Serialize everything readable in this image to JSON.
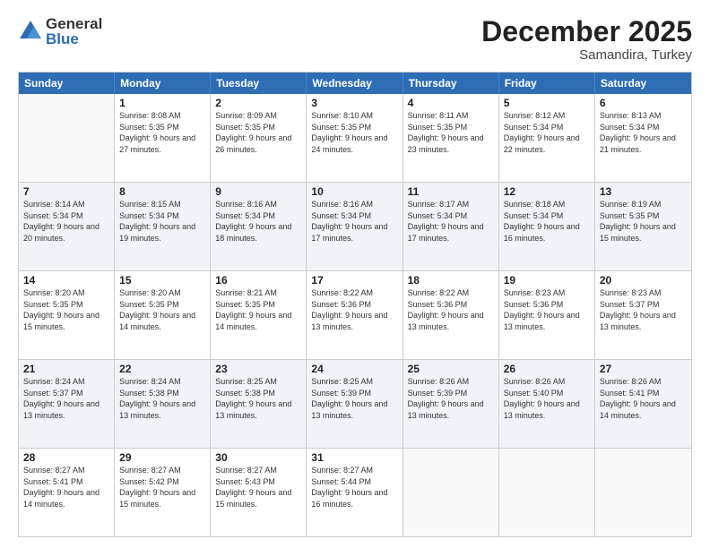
{
  "logo": {
    "general": "General",
    "blue": "Blue"
  },
  "title": {
    "month": "December 2025",
    "location": "Samandira, Turkey"
  },
  "header_days": [
    "Sunday",
    "Monday",
    "Tuesday",
    "Wednesday",
    "Thursday",
    "Friday",
    "Saturday"
  ],
  "rows": [
    {
      "cells": [
        {
          "day": "",
          "sunrise": "",
          "sunset": "",
          "daylight": "",
          "empty": true
        },
        {
          "day": "1",
          "sunrise": "Sunrise: 8:08 AM",
          "sunset": "Sunset: 5:35 PM",
          "daylight": "Daylight: 9 hours and 27 minutes."
        },
        {
          "day": "2",
          "sunrise": "Sunrise: 8:09 AM",
          "sunset": "Sunset: 5:35 PM",
          "daylight": "Daylight: 9 hours and 26 minutes."
        },
        {
          "day": "3",
          "sunrise": "Sunrise: 8:10 AM",
          "sunset": "Sunset: 5:35 PM",
          "daylight": "Daylight: 9 hours and 24 minutes."
        },
        {
          "day": "4",
          "sunrise": "Sunrise: 8:11 AM",
          "sunset": "Sunset: 5:35 PM",
          "daylight": "Daylight: 9 hours and 23 minutes."
        },
        {
          "day": "5",
          "sunrise": "Sunrise: 8:12 AM",
          "sunset": "Sunset: 5:34 PM",
          "daylight": "Daylight: 9 hours and 22 minutes."
        },
        {
          "day": "6",
          "sunrise": "Sunrise: 8:13 AM",
          "sunset": "Sunset: 5:34 PM",
          "daylight": "Daylight: 9 hours and 21 minutes."
        }
      ]
    },
    {
      "cells": [
        {
          "day": "7",
          "sunrise": "Sunrise: 8:14 AM",
          "sunset": "Sunset: 5:34 PM",
          "daylight": "Daylight: 9 hours and 20 minutes."
        },
        {
          "day": "8",
          "sunrise": "Sunrise: 8:15 AM",
          "sunset": "Sunset: 5:34 PM",
          "daylight": "Daylight: 9 hours and 19 minutes."
        },
        {
          "day": "9",
          "sunrise": "Sunrise: 8:16 AM",
          "sunset": "Sunset: 5:34 PM",
          "daylight": "Daylight: 9 hours and 18 minutes."
        },
        {
          "day": "10",
          "sunrise": "Sunrise: 8:16 AM",
          "sunset": "Sunset: 5:34 PM",
          "daylight": "Daylight: 9 hours and 17 minutes."
        },
        {
          "day": "11",
          "sunrise": "Sunrise: 8:17 AM",
          "sunset": "Sunset: 5:34 PM",
          "daylight": "Daylight: 9 hours and 17 minutes."
        },
        {
          "day": "12",
          "sunrise": "Sunrise: 8:18 AM",
          "sunset": "Sunset: 5:34 PM",
          "daylight": "Daylight: 9 hours and 16 minutes."
        },
        {
          "day": "13",
          "sunrise": "Sunrise: 8:19 AM",
          "sunset": "Sunset: 5:35 PM",
          "daylight": "Daylight: 9 hours and 15 minutes."
        }
      ]
    },
    {
      "cells": [
        {
          "day": "14",
          "sunrise": "Sunrise: 8:20 AM",
          "sunset": "Sunset: 5:35 PM",
          "daylight": "Daylight: 9 hours and 15 minutes."
        },
        {
          "day": "15",
          "sunrise": "Sunrise: 8:20 AM",
          "sunset": "Sunset: 5:35 PM",
          "daylight": "Daylight: 9 hours and 14 minutes."
        },
        {
          "day": "16",
          "sunrise": "Sunrise: 8:21 AM",
          "sunset": "Sunset: 5:35 PM",
          "daylight": "Daylight: 9 hours and 14 minutes."
        },
        {
          "day": "17",
          "sunrise": "Sunrise: 8:22 AM",
          "sunset": "Sunset: 5:36 PM",
          "daylight": "Daylight: 9 hours and 13 minutes."
        },
        {
          "day": "18",
          "sunrise": "Sunrise: 8:22 AM",
          "sunset": "Sunset: 5:36 PM",
          "daylight": "Daylight: 9 hours and 13 minutes."
        },
        {
          "day": "19",
          "sunrise": "Sunrise: 8:23 AM",
          "sunset": "Sunset: 5:36 PM",
          "daylight": "Daylight: 9 hours and 13 minutes."
        },
        {
          "day": "20",
          "sunrise": "Sunrise: 8:23 AM",
          "sunset": "Sunset: 5:37 PM",
          "daylight": "Daylight: 9 hours and 13 minutes."
        }
      ]
    },
    {
      "cells": [
        {
          "day": "21",
          "sunrise": "Sunrise: 8:24 AM",
          "sunset": "Sunset: 5:37 PM",
          "daylight": "Daylight: 9 hours and 13 minutes."
        },
        {
          "day": "22",
          "sunrise": "Sunrise: 8:24 AM",
          "sunset": "Sunset: 5:38 PM",
          "daylight": "Daylight: 9 hours and 13 minutes."
        },
        {
          "day": "23",
          "sunrise": "Sunrise: 8:25 AM",
          "sunset": "Sunset: 5:38 PM",
          "daylight": "Daylight: 9 hours and 13 minutes."
        },
        {
          "day": "24",
          "sunrise": "Sunrise: 8:25 AM",
          "sunset": "Sunset: 5:39 PM",
          "daylight": "Daylight: 9 hours and 13 minutes."
        },
        {
          "day": "25",
          "sunrise": "Sunrise: 8:26 AM",
          "sunset": "Sunset: 5:39 PM",
          "daylight": "Daylight: 9 hours and 13 minutes."
        },
        {
          "day": "26",
          "sunrise": "Sunrise: 8:26 AM",
          "sunset": "Sunset: 5:40 PM",
          "daylight": "Daylight: 9 hours and 13 minutes."
        },
        {
          "day": "27",
          "sunrise": "Sunrise: 8:26 AM",
          "sunset": "Sunset: 5:41 PM",
          "daylight": "Daylight: 9 hours and 14 minutes."
        }
      ]
    },
    {
      "cells": [
        {
          "day": "28",
          "sunrise": "Sunrise: 8:27 AM",
          "sunset": "Sunset: 5:41 PM",
          "daylight": "Daylight: 9 hours and 14 minutes."
        },
        {
          "day": "29",
          "sunrise": "Sunrise: 8:27 AM",
          "sunset": "Sunset: 5:42 PM",
          "daylight": "Daylight: 9 hours and 15 minutes."
        },
        {
          "day": "30",
          "sunrise": "Sunrise: 8:27 AM",
          "sunset": "Sunset: 5:43 PM",
          "daylight": "Daylight: 9 hours and 15 minutes."
        },
        {
          "day": "31",
          "sunrise": "Sunrise: 8:27 AM",
          "sunset": "Sunset: 5:44 PM",
          "daylight": "Daylight: 9 hours and 16 minutes."
        },
        {
          "day": "",
          "sunrise": "",
          "sunset": "",
          "daylight": "",
          "empty": true
        },
        {
          "day": "",
          "sunrise": "",
          "sunset": "",
          "daylight": "",
          "empty": true
        },
        {
          "day": "",
          "sunrise": "",
          "sunset": "",
          "daylight": "",
          "empty": true
        }
      ]
    }
  ]
}
